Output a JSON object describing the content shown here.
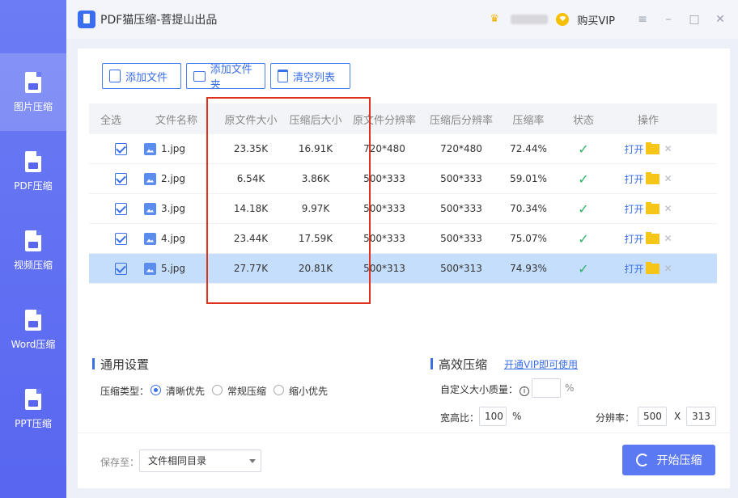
{
  "app": {
    "title": "PDF猫压缩-菩提山出品",
    "buy_vip": "购买VIP"
  },
  "sidebar": {
    "items": [
      {
        "label": "图片压缩",
        "active": true
      },
      {
        "label": "PDF压缩",
        "active": false
      },
      {
        "label": "视频压缩",
        "active": false
      },
      {
        "label": "Word压缩",
        "active": false
      },
      {
        "label": "PPT压缩",
        "active": false
      }
    ]
  },
  "toolbar": {
    "add_file": "添加文件",
    "add_folder": "添加文件夹",
    "clear_list": "清空列表"
  },
  "table": {
    "headers": [
      "全选",
      "文件名称",
      "原文件大小",
      "压缩后大小",
      "原文件分辨率",
      "压缩后分辨率",
      "压缩率",
      "状态",
      "操作"
    ],
    "open_label": "打开",
    "rows": [
      {
        "name": "1.jpg",
        "orig_size": "23.35K",
        "comp_size": "16.91K",
        "orig_res": "720*480",
        "comp_res": "720*480",
        "rate": "72.44%",
        "checked": true,
        "selected": false
      },
      {
        "name": "2.jpg",
        "orig_size": "6.54K",
        "comp_size": "3.86K",
        "orig_res": "500*333",
        "comp_res": "500*333",
        "rate": "59.01%",
        "checked": true,
        "selected": false
      },
      {
        "name": "3.jpg",
        "orig_size": "14.18K",
        "comp_size": "9.97K",
        "orig_res": "500*333",
        "comp_res": "500*333",
        "rate": "70.34%",
        "checked": true,
        "selected": false
      },
      {
        "name": "4.jpg",
        "orig_size": "23.44K",
        "comp_size": "17.59K",
        "orig_res": "500*333",
        "comp_res": "500*333",
        "rate": "75.07%",
        "checked": true,
        "selected": false
      },
      {
        "name": "5.jpg",
        "orig_size": "27.77K",
        "comp_size": "20.81K",
        "orig_res": "500*313",
        "comp_res": "500*313",
        "rate": "74.93%",
        "checked": true,
        "selected": true
      }
    ]
  },
  "general": {
    "title": "通用设置",
    "type_label": "压缩类型：",
    "options": [
      "清晰优先",
      "常规压缩",
      "缩小优先"
    ],
    "selected_option": "清晰优先"
  },
  "advanced": {
    "title": "高效压缩",
    "vip_link": "开通VIP即可使用",
    "custom_quality_label": "自定义大小质量：",
    "percent": "%",
    "aspect_label": "宽高比：",
    "aspect_value": "100",
    "resolution_label": "分辨率：",
    "res_w": "500",
    "res_x": "X",
    "res_h": "313"
  },
  "footer": {
    "save_to_label": "保存至：",
    "save_to_value": "文件相同目录",
    "start_button": "开始压缩"
  },
  "colors": {
    "accent": "#3b6fe8",
    "sidebar": "#5866f0",
    "selected_row": "#c5defb",
    "highlight_box": "#e0301e",
    "status_ok": "#2db36a"
  }
}
